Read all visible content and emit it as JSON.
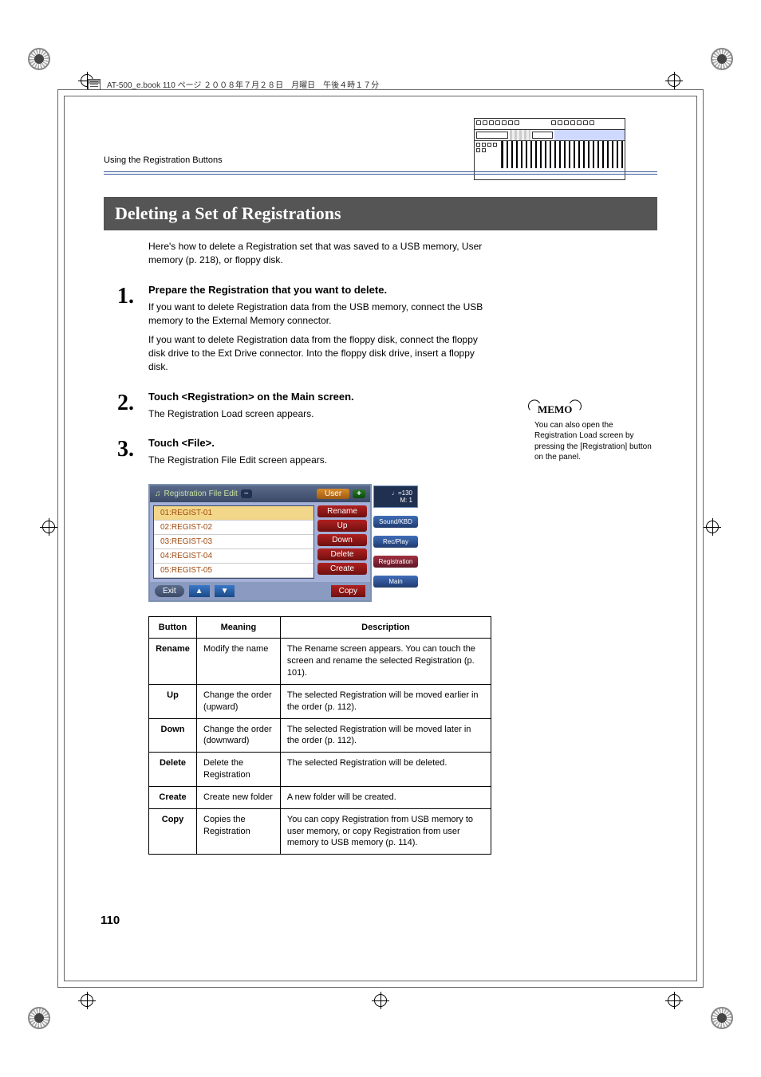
{
  "header_text": "AT-500_e.book  110 ページ  ２００８年７月２８日　月曜日　午後４時１７分",
  "section_path": "Using the Registration Buttons",
  "title": "Deleting a Set of Registrations",
  "intro": "Here's how to delete a Registration set that was saved to a USB memory, User memory (p. 218), or floppy disk.",
  "steps": [
    {
      "num": "1.",
      "title": "Prepare the Registration that you want to delete.",
      "paras": [
        "If you want to delete Registration data from the USB memory, connect the USB memory to the External Memory connector.",
        "If you want to delete Registration data from the floppy disk, connect the floppy disk drive to the Ext Drive connector. Into the floppy disk drive, insert a floppy disk."
      ]
    },
    {
      "num": "2.",
      "title": "Touch <Registration> on the Main screen.",
      "paras": [
        "The Registration Load screen appears."
      ]
    },
    {
      "num": "3.",
      "title": "Touch <File>.",
      "paras": [
        "The Registration File Edit screen appears."
      ]
    }
  ],
  "ui": {
    "top_title": "Registration File Edit",
    "user_label": "User",
    "plus": "+",
    "list": [
      "01:REGIST-01",
      "02:REGIST-02",
      "03:REGIST-03",
      "04:REGIST-04",
      "05:REGIST-05"
    ],
    "actions": [
      "Rename",
      "Up",
      "Down",
      "Delete",
      "Create"
    ],
    "exit": "Exit",
    "copy": "Copy",
    "side": {
      "tempo_line1": "♩=130",
      "tempo_line2": "M:   1",
      "sound": "Sound/KBD",
      "rec": "Rec/Play",
      "reg": "Registration",
      "main": "Main"
    }
  },
  "table": {
    "headers": [
      "Button",
      "Meaning",
      "Description"
    ],
    "rows": [
      [
        "Rename",
        "Modify the name",
        "The Rename screen appears. You can touch the screen and rename the selected Registration (p. 101)."
      ],
      [
        "Up",
        "Change the order (upward)",
        "The selected Registration will be moved earlier in the order (p. 112)."
      ],
      [
        "Down",
        "Change the order (downward)",
        "The selected Registration will be moved later in the order (p. 112)."
      ],
      [
        "Delete",
        "Delete the Registration",
        "The selected Registration will be deleted."
      ],
      [
        "Create",
        "Create new folder",
        "A new folder will be created."
      ],
      [
        "Copy",
        "Copies the Registration",
        "You can copy Registration from USB memory to user memory, or copy Registration from user memory to USB memory (p. 114)."
      ]
    ]
  },
  "memo": {
    "label": "MEMO",
    "text": "You can also open the Registration Load screen by pressing the [Registration] button on the panel."
  },
  "page_number": "110"
}
